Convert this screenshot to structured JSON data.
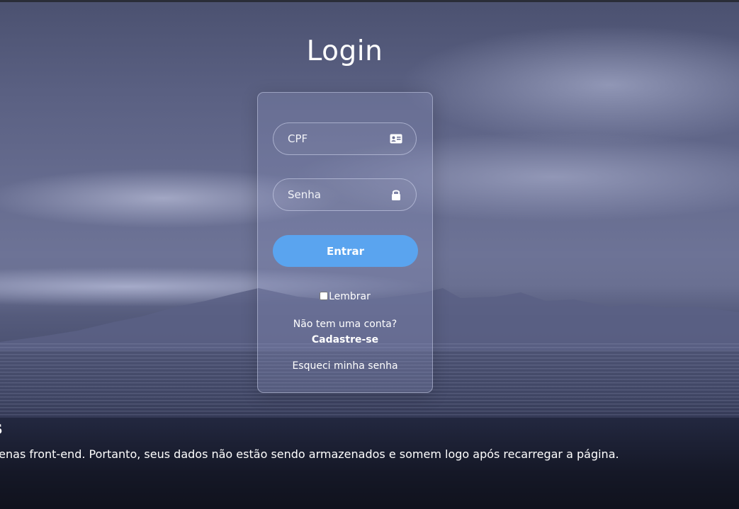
{
  "page": {
    "title": "Login"
  },
  "form": {
    "cpf": {
      "placeholder": "CPF",
      "value": "",
      "icon": "id-card-icon"
    },
    "senha": {
      "placeholder": "Senha",
      "value": "",
      "icon": "lock-icon"
    },
    "submit_label": "Entrar",
    "remember_label": "Lembrar",
    "remember_checked": false,
    "no_account_text": "Não tem uma conta?",
    "signup_label": "Cadastre-se",
    "forgot_label": "Esqueci minha senha"
  },
  "notice": {
    "heading_partial": "s",
    "text_partial": "penas front-end. Portanto, seus dados não estão sendo armazenados e somem logo após recarregar a página."
  },
  "colors": {
    "button": "#5aa4ef",
    "text": "#ffffff",
    "background_tint": "#5e6488"
  }
}
